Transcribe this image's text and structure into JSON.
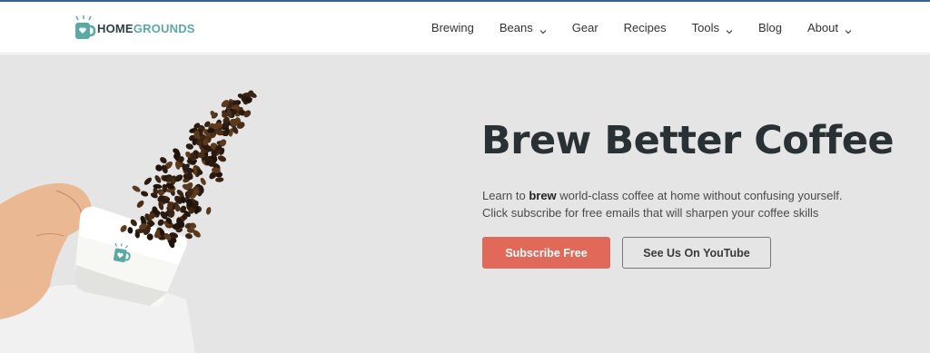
{
  "brand": {
    "name_part1": "HOME",
    "name_part2": "GROUNDS"
  },
  "nav": {
    "items": [
      {
        "label": "Brewing",
        "has_dropdown": false
      },
      {
        "label": "Beans",
        "has_dropdown": true
      },
      {
        "label": "Gear",
        "has_dropdown": false
      },
      {
        "label": "Recipes",
        "has_dropdown": false
      },
      {
        "label": "Tools",
        "has_dropdown": true
      },
      {
        "label": "Blog",
        "has_dropdown": false
      },
      {
        "label": "About",
        "has_dropdown": true
      }
    ]
  },
  "hero": {
    "headline": "Brew Better Coffee",
    "sub_line1_prefix": "Learn to ",
    "sub_line1_bold": "brew",
    "sub_line1_suffix": " world-class coffee at home without confusing yourself.",
    "sub_line2": "Click subscribe for free emails that will sharpen your coffee skills",
    "subscribe_label": "Subscribe Free",
    "youtube_label": "See Us On YouTube"
  },
  "colors": {
    "accent": "#e0695a",
    "brand_teal": "#5aa9a6",
    "dark_text": "#2a3135",
    "hero_bg": "#e5e5e5"
  }
}
